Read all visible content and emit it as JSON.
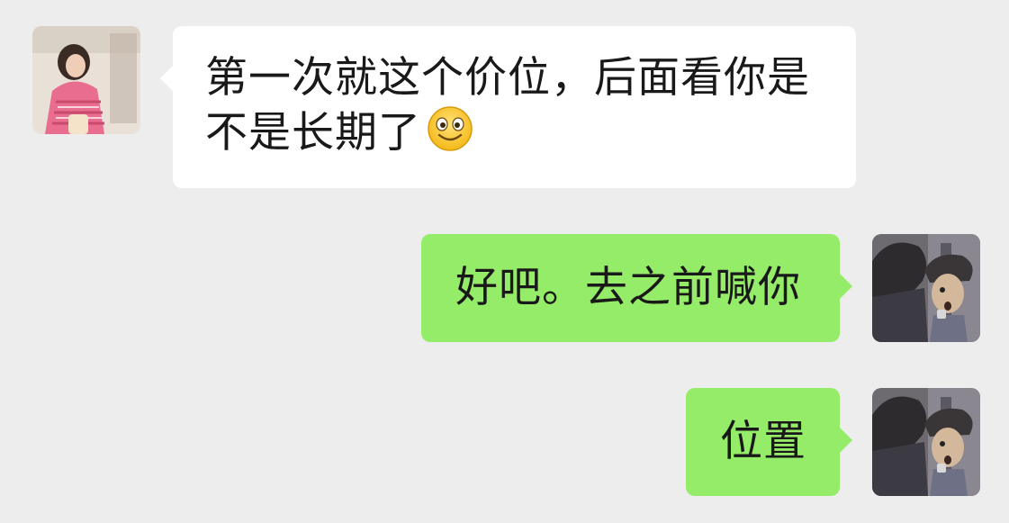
{
  "chat": {
    "messages": [
      {
        "sender": "contact",
        "text_line1": "第一次就这个价位，后面看你是",
        "text_line2": "不是长期了",
        "emoji": "smiling-face-emoji"
      },
      {
        "sender": "me",
        "text": "好吧。去之前喊你"
      },
      {
        "sender": "me",
        "text": "位置"
      }
    ]
  },
  "theme": {
    "background": "#ededed",
    "incoming_bubble": "#ffffff",
    "outgoing_bubble": "#95ec69",
    "text": "#191919"
  },
  "icons": {
    "contact_avatar": "contact-avatar-photo",
    "my_avatar": "my-avatar-photo",
    "emoji": "smiling-face-emoji"
  }
}
